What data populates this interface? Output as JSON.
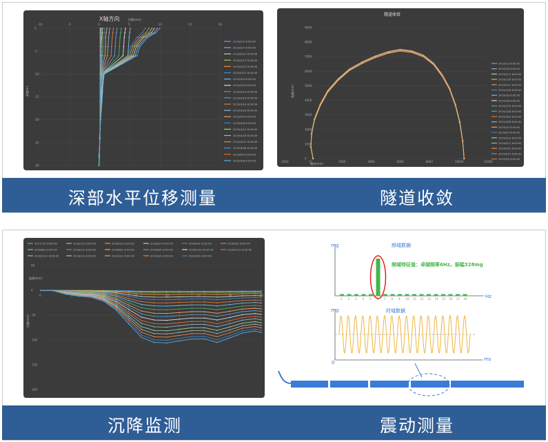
{
  "captions": {
    "deep": "深部水平位移测量",
    "tunnel": "隧道收敛",
    "settle": "沉降监测",
    "vib": "震动测量"
  },
  "chart_data": [
    {
      "type": "line",
      "title": "X轴方向",
      "xlabel": "位移(mm)",
      "ylabel": "深度(m)",
      "xlim": [
        -10,
        20
      ],
      "ylim": [
        -30,
        0
      ],
      "x_ticks": [
        "-10",
        "-5",
        "0",
        "5",
        "10",
        "15",
        "20"
      ],
      "y_ticks": [
        "0",
        "-5",
        "-10",
        "-15",
        "-20",
        "-25",
        "-30"
      ],
      "legend_position": "right",
      "series": [
        {
          "name": "2019/2/1 8:00:00",
          "color": "#5aa7e8",
          "x": [
            9.9,
            9.2,
            7.9,
            6.6,
            6.1,
            0.7,
            0.5,
            0.4,
            0.3,
            0.2,
            0.1,
            0.0,
            0.0,
            -0.1,
            -0.1,
            -0.2
          ],
          "y": [
            0,
            -1,
            -2,
            -4,
            -6,
            -10,
            -12,
            -14,
            -16,
            -18,
            -20,
            -22,
            -24,
            -26,
            -28,
            -30
          ]
        },
        {
          "name": "2019/2/7 8:00:00",
          "color": "#7fb0e0",
          "x": [
            9.5,
            8.9,
            7.6,
            6.3,
            5.8,
            0.6,
            0.4,
            0.3,
            0.2,
            0.1,
            0.0,
            0.0,
            -0.1,
            -0.1,
            -0.2,
            -0.2
          ],
          "y": [
            0,
            -1,
            -2,
            -4,
            -6,
            -10,
            -12,
            -14,
            -16,
            -18,
            -20,
            -22,
            -24,
            -26,
            -28,
            -30
          ]
        },
        {
          "name": "2019/2/12 8:00:00",
          "color": "#c7c7c7",
          "x": [
            9.0,
            8.5,
            7.2,
            6.0,
            5.5,
            0.5,
            0.4,
            0.3,
            0.2,
            0.1,
            0.0,
            0.0,
            -0.1,
            -0.1,
            -0.2,
            -0.2
          ],
          "y": [
            0,
            -1,
            -2,
            -4,
            -6,
            -10,
            -12,
            -14,
            -16,
            -18,
            -20,
            -22,
            -24,
            -26,
            -28,
            -30
          ]
        },
        {
          "name": "2019/2/17 8:00:00",
          "color": "#9ec95a",
          "x": [
            8.6,
            8.1,
            6.9,
            5.7,
            5.2,
            0.5,
            0.3,
            0.2,
            0.1,
            0.1,
            0.0,
            0.0,
            -0.1,
            -0.1,
            -0.2,
            -0.2
          ],
          "y": [
            0,
            -1,
            -2,
            -4,
            -6,
            -10,
            -12,
            -14,
            -16,
            -18,
            -20,
            -22,
            -24,
            -26,
            -28,
            -30
          ]
        },
        {
          "name": "2019/2/22 8:00:00",
          "color": "#e8923f",
          "x": [
            8.1,
            7.6,
            6.5,
            5.4,
            4.9,
            0.4,
            0.3,
            0.2,
            0.1,
            0.1,
            0.0,
            0.0,
            -0.1,
            -0.1,
            -0.2,
            -0.2
          ],
          "y": [
            0,
            -1,
            -2,
            -4,
            -6,
            -10,
            -12,
            -14,
            -16,
            -18,
            -20,
            -22,
            -24,
            -26,
            -28,
            -30
          ]
        },
        {
          "name": "2019/2/27 8:00:00",
          "color": "#4a86c5",
          "x": [
            7.5,
            7.0,
            6.1,
            5.1,
            4.6,
            0.4,
            0.3,
            0.2,
            0.1,
            0.0,
            0.0,
            0.0,
            -0.1,
            -0.1,
            -0.2,
            -0.2
          ],
          "y": [
            0,
            -1,
            -2,
            -4,
            -6,
            -10,
            -12,
            -14,
            -16,
            -18,
            -20,
            -22,
            -24,
            -26,
            -28,
            -30
          ]
        },
        {
          "name": "2019/3/4 8:00:00",
          "color": "#6dbde0",
          "x": [
            5.0,
            4.9,
            4.8,
            4.7,
            4.6,
            0.3,
            0.2,
            0.2,
            0.1,
            0.0,
            0.0,
            0.0,
            -0.1,
            -0.1,
            -0.2,
            -0.2
          ],
          "y": [
            0,
            -1,
            -2,
            -4,
            -6,
            -10,
            -12,
            -14,
            -16,
            -18,
            -20,
            -22,
            -24,
            -26,
            -28,
            -30
          ]
        },
        {
          "name": "2019/3/9 8:00:00",
          "color": "#d9d9d9",
          "x": [
            4.2,
            4.1,
            4.0,
            3.9,
            3.8,
            0.3,
            0.2,
            0.1,
            0.1,
            0.0,
            0.0,
            0.0,
            -0.1,
            -0.1,
            -0.2,
            -0.2
          ],
          "y": [
            0,
            -1,
            -2,
            -4,
            -6,
            -10,
            -12,
            -14,
            -16,
            -18,
            -20,
            -22,
            -24,
            -26,
            -28,
            -30
          ]
        },
        {
          "name": "2019/3/14 8:00:00",
          "color": "#4fae6a",
          "x": [
            3.5,
            3.4,
            3.3,
            3.2,
            3.1,
            0.3,
            0.2,
            0.1,
            0.1,
            0.0,
            0.0,
            0.0,
            -0.1,
            -0.1,
            -0.2,
            -0.2
          ],
          "y": [
            0,
            -1,
            -2,
            -4,
            -6,
            -10,
            -12,
            -14,
            -16,
            -18,
            -20,
            -22,
            -24,
            -26,
            -28,
            -30
          ]
        },
        {
          "name": "2019/3/19 8:00:00",
          "color": "#5c9ad6",
          "x": [
            2.8,
            2.7,
            2.6,
            2.5,
            2.4,
            0.2,
            0.2,
            0.1,
            0.1,
            0.0,
            0.0,
            0.0,
            -0.1,
            -0.1,
            -0.2,
            -0.2
          ],
          "y": [
            0,
            -1,
            -2,
            -4,
            -6,
            -10,
            -12,
            -14,
            -16,
            -18,
            -20,
            -22,
            -24,
            -26,
            -28,
            -30
          ]
        },
        {
          "name": "2019/3/24 8:00:00",
          "color": "#e07a3a",
          "x": [
            2.2,
            2.1,
            2.0,
            1.9,
            1.8,
            0.2,
            0.1,
            0.1,
            0.0,
            0.0,
            0.0,
            0.0,
            -0.1,
            -0.1,
            -0.2,
            -0.2
          ],
          "y": [
            0,
            -1,
            -2,
            -4,
            -6,
            -10,
            -12,
            -14,
            -16,
            -18,
            -20,
            -22,
            -24,
            -26,
            -28,
            -30
          ]
        },
        {
          "name": "2019/3/29 8:00:00",
          "color": "#8db4d9",
          "x": [
            1.6,
            1.5,
            1.4,
            1.3,
            1.2,
            0.2,
            0.1,
            0.1,
            0.0,
            0.0,
            0.0,
            0.0,
            -0.1,
            -0.1,
            -0.2,
            -0.2
          ],
          "y": [
            0,
            -1,
            -2,
            -4,
            -6,
            -10,
            -12,
            -14,
            -16,
            -18,
            -20,
            -22,
            -24,
            -26,
            -28,
            -30
          ]
        },
        {
          "name": "2019/4/3 8:00:00",
          "color": "#f2a35a",
          "x": [
            1.1,
            1.0,
            0.9,
            0.9,
            0.8,
            0.1,
            0.1,
            0.0,
            0.0,
            0.0,
            0.0,
            0.0,
            -0.1,
            -0.1,
            -0.2,
            -0.2
          ],
          "y": [
            0,
            -1,
            -2,
            -4,
            -6,
            -10,
            -12,
            -14,
            -16,
            -18,
            -20,
            -22,
            -24,
            -26,
            -28,
            -30
          ]
        },
        {
          "name": "2019/4/8 8:00:00",
          "color": "#3c7fc0",
          "x": [
            0.7,
            0.7,
            0.6,
            0.6,
            0.5,
            0.1,
            0.1,
            0.0,
            0.0,
            0.0,
            0.0,
            0.0,
            -0.1,
            -0.1,
            -0.2,
            -0.2
          ],
          "y": [
            0,
            -1,
            -2,
            -4,
            -6,
            -10,
            -12,
            -14,
            -16,
            -18,
            -20,
            -22,
            -24,
            -26,
            -28,
            -30
          ]
        },
        {
          "name": "2019/4/13 8:00:00",
          "color": "#9fd08a",
          "x": [
            0.4,
            0.4,
            0.3,
            0.3,
            0.3,
            0.1,
            0.0,
            0.0,
            0.0,
            0.0,
            0.0,
            0.0,
            -0.1,
            -0.1,
            -0.2,
            -0.2
          ],
          "y": [
            0,
            -1,
            -2,
            -4,
            -6,
            -10,
            -12,
            -14,
            -16,
            -18,
            -20,
            -22,
            -24,
            -26,
            -28,
            -30
          ]
        },
        {
          "name": "2019/4/18 8:00:00",
          "color": "#b0b0b0",
          "x": [
            0.2,
            0.2,
            0.2,
            0.1,
            0.1,
            0.0,
            0.0,
            0.0,
            0.0,
            0.0,
            0.0,
            0.0,
            -0.1,
            -0.1,
            -0.2,
            -0.2
          ],
          "y": [
            0,
            -1,
            -2,
            -4,
            -6,
            -10,
            -12,
            -14,
            -16,
            -18,
            -20,
            -22,
            -24,
            -26,
            -28,
            -30
          ]
        },
        {
          "name": "2019/4/23 8:00:00",
          "color": "#e6894b",
          "x": [
            0.1,
            0.1,
            0.1,
            0.1,
            0.0,
            0.0,
            0.0,
            0.0,
            0.0,
            0.0,
            0.0,
            0.0,
            -0.1,
            -0.1,
            -0.2,
            -0.2
          ],
          "y": [
            0,
            -1,
            -2,
            -4,
            -6,
            -10,
            -12,
            -14,
            -16,
            -18,
            -20,
            -22,
            -24,
            -26,
            -28,
            -30
          ]
        },
        {
          "name": "2019/4/28 8:00:00",
          "color": "#5b8fd0",
          "x": [
            0.0,
            0.0,
            0.0,
            0.0,
            0.0,
            0.0,
            0.0,
            0.0,
            0.0,
            0.0,
            0.0,
            0.0,
            -0.1,
            -0.1,
            -0.2,
            -0.2
          ],
          "y": [
            0,
            -1,
            -2,
            -4,
            -6,
            -10,
            -12,
            -14,
            -16,
            -18,
            -20,
            -22,
            -24,
            -26,
            -28,
            -30
          ]
        },
        {
          "name": "2019/5/3 8:00:00",
          "color": "#e76d2e",
          "x": [
            0.0,
            0.0,
            0.0,
            0.0,
            0.0,
            0.0,
            0.0,
            0.0,
            0.0,
            0.0,
            0.0,
            0.0,
            -0.1,
            -0.1,
            -0.2,
            -0.2
          ],
          "y": [
            0,
            -1,
            -2,
            -4,
            -6,
            -10,
            -12,
            -14,
            -16,
            -18,
            -20,
            -22,
            -24,
            -26,
            -28,
            -30
          ]
        },
        {
          "name": "2019/5/8 8:00:00",
          "color": "#57b3d4",
          "x": [
            0.0,
            0.0,
            0.0,
            0.0,
            0.0,
            0.0,
            0.0,
            0.0,
            0.0,
            0.0,
            0.0,
            0.0,
            -0.1,
            -0.1,
            -0.2,
            -0.2
          ],
          "y": [
            0,
            -1,
            -2,
            -4,
            -6,
            -10,
            -12,
            -14,
            -16,
            -18,
            -20,
            -22,
            -24,
            -26,
            -28,
            -30
          ]
        }
      ]
    },
    {
      "type": "line",
      "title": "隧道收敛",
      "xlabel": "横向(mm)",
      "ylabel": "高度(mm)",
      "xlim": [
        -2000,
        12000
      ],
      "ylim": [
        0,
        9000
      ],
      "x_ticks": [
        "-2000",
        "0",
        "2000",
        "4000",
        "6000",
        "8000",
        "10000",
        "12000"
      ],
      "y_ticks": [
        "0",
        "1000",
        "2000",
        "3000",
        "4000",
        "5000",
        "6000",
        "7000",
        "8000",
        "9000"
      ],
      "legend_position": "right",
      "series_names": [
        "2019/2/1 8:00:00",
        "2019/2/6 8:00:00",
        "2019/2/11 8:00:00",
        "2019/2/16 8:00:00",
        "2019/2/21 8:00:00",
        "2019/2/26 8:00:00",
        "2019/3/3 8:00:00",
        "2019/3/8 8:00:00",
        "2019/3/13 8:00:00",
        "2019/3/18 8:00:00",
        "2019/3/23 8:00:00",
        "2019/3/28 8:00:00",
        "2019/4/2 8:00:00",
        "2019/4/7 8:00:00",
        "2019/4/12 8:00:00",
        "2019/4/17 8:00:00",
        "2019/4/22 8:00:00",
        "2019/4/27 8:00:00",
        "2019/5/2 8:00:00"
      ],
      "series_colors": [
        "#5aa7e8",
        "#7fb0e0",
        "#c7c7c7",
        "#9ec95a",
        "#e8923f",
        "#4a86c5",
        "#6dbde0",
        "#d9d9d9",
        "#4fae6a",
        "#5c9ad6",
        "#e07a3a",
        "#8db4d9",
        "#f2a35a",
        "#3c7fc0",
        "#9fd08a",
        "#b0b0b0",
        "#e6894b",
        "#5b8fd0",
        "#e76d2e"
      ],
      "profile": {
        "x": [
          0,
          -150,
          -100,
          100,
          500,
          1000,
          1700,
          2500,
          3400,
          4300,
          5200,
          6000,
          6800,
          7600,
          8300,
          8900,
          9400,
          9800,
          10100,
          10300,
          10400
        ],
        "y": [
          0,
          800,
          1700,
          2700,
          3700,
          4600,
          5400,
          6100,
          6600,
          7000,
          7300,
          7450,
          7350,
          7050,
          6500,
          5700,
          4800,
          3700,
          2500,
          1200,
          0
        ]
      }
    },
    {
      "type": "line",
      "title": "",
      "ylabel": "位移(mm)",
      "annotation": "监测(mm)",
      "xlim": [
        0,
        35
      ],
      "ylim": [
        -200,
        50
      ],
      "x_ticks": [
        "0",
        "5",
        "10",
        "15",
        "20",
        "25",
        "30",
        "35"
      ],
      "y_ticks": [
        "50",
        "0",
        "-50",
        "-100",
        "-150",
        "-200"
      ],
      "legend_position": "top",
      "legend": [
        "2017/7/1 8:00:00",
        "2018/1/1 8:00:00",
        "2018/2/1 8:00:00",
        "2018/3/1 8:00:00",
        "2018/4/1 8:00:00",
        "2018/5/1 8:00:00",
        "2018/6/1 8:00:00",
        "2018/7/1 8:00:00",
        "2018/8/1 8:00:00",
        "2018/9/1 8:00:00",
        "2018/10/1 8:00:00",
        "2018/11/1 8:00:00",
        "2018/12/1 8:00:00",
        "2019/1/1 8:00:00",
        "2019/2/1 8:00:00",
        "2019/3/1 8:00:00",
        "2019/4/1 8:00:00"
      ],
      "legend_colors": [
        "#5aa7e8",
        "#9ec95a",
        "#e8923f",
        "#c7c7c7",
        "#4a86c5",
        "#e07a3a",
        "#6dbde0",
        "#4fae6a",
        "#f2a35a",
        "#5c9ad6",
        "#d9d9d9",
        "#e76d2e",
        "#8db4d9",
        "#9fd08a",
        "#b0b0b0",
        "#e6894b",
        "#3c7fc0"
      ],
      "x": [
        0,
        2,
        4,
        6,
        8,
        10,
        12,
        14,
        16,
        18,
        20,
        22,
        24,
        26,
        28,
        30,
        32,
        34,
        35
      ],
      "depth_factors": [
        0.02,
        0.04,
        0.08,
        0.13,
        0.18,
        0.24,
        0.3,
        0.37,
        0.44,
        0.5,
        0.57,
        0.64,
        0.7,
        0.77,
        0.83,
        0.89,
        0.95,
        1.0
      ],
      "base_profile": [
        0,
        -3,
        -8,
        -12,
        -16,
        -22,
        -40,
        -70,
        -95,
        -105,
        -108,
        -102,
        -98,
        -100,
        -105,
        -96,
        -88,
        -82,
        -85
      ]
    },
    {
      "type": "bar",
      "title": "频域数据",
      "ylabel": "mg",
      "xlabel": "Hz",
      "annotation": "频域特征值：卓越频率6Hz，振幅328mg",
      "categories": [
        "1",
        "2",
        "3",
        "4",
        "5",
        "6",
        "7",
        "8",
        "9",
        "10",
        "11",
        "12",
        "13",
        "14",
        "15",
        "16",
        "17",
        "18"
      ],
      "values": [
        4,
        6,
        5,
        7,
        6,
        328,
        9,
        8,
        6,
        7,
        5,
        6,
        4,
        5,
        7,
        6,
        5,
        6
      ]
    },
    {
      "type": "line",
      "title": "时域数据",
      "ylabel": "mg",
      "xlabel": "ms",
      "cycles": 18,
      "origin_label": "0"
    }
  ]
}
